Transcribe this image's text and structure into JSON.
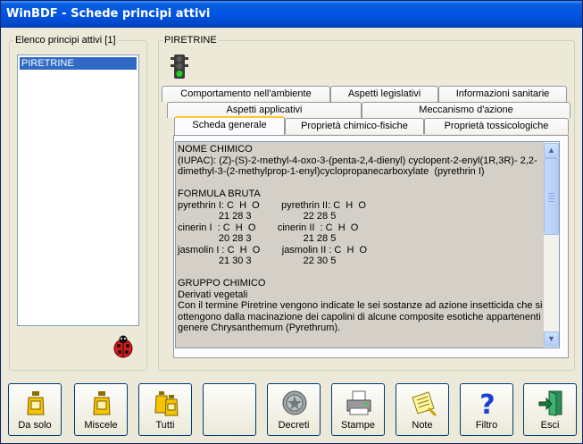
{
  "window": {
    "title": "WinBDF - Schede principi attivi"
  },
  "left_panel": {
    "legend": "Elenco principi attivi [1]",
    "items": [
      "PIRETRINE"
    ]
  },
  "right_panel": {
    "legend": "PIRETRINE",
    "tabs_row1": [
      "Comportamento nell'ambiente",
      "Aspetti legislativi",
      "Informazioni sanitarie"
    ],
    "tabs_row2": [
      "Aspetti applicativi",
      "Meccanismo d'azione"
    ],
    "tabs_row3": [
      "Scheda generale",
      "Proprietà chimico-fisiche",
      "Proprietà tossicologiche"
    ],
    "active_tab": "Scheda generale",
    "content_lines": [
      "NOME CHIMICO",
      "(IUPAC): (Z)-(S)-2-methyl-4-oxo-3-(penta-2,4-dienyl) cyclopent-2-enyl(1R,3R)- 2,2-",
      "dimethyl-3-(2-methylprop-1-enyl)cyclopropanecarboxylate  (pyrethrin I)",
      "",
      "FORMULA BRUTA",
      "pyrethrin I: C  H  O        pyrethrin II: C  H  O",
      "               21 28 3                   22 28 5",
      "cinerin I  : C  H  O        cinerin II  : C  H  O",
      "               20 28 3                   21 28 5",
      "jasmolin I : C  H  O        jasmolin II : C  H  O",
      "               21 30 3                   22 30 5",
      "",
      "GRUPPO CHIMICO",
      "Derivati vegetali",
      "Con il termine Piretrine vengono indicate le sei sostanze ad azione insetticida che si",
      "ottengono dalla macinazione dei capolini di alcune composite esotiche appartenenti al",
      "genere Chrysanthemum (Pyrethrum)."
    ]
  },
  "toolbar": {
    "buttons": [
      {
        "label": "Da solo",
        "icon": "bottle-icon"
      },
      {
        "label": "Miscele",
        "icon": "bottle-icon"
      },
      {
        "label": "Tutti",
        "icon": "bottles-icon"
      },
      {
        "label": "",
        "icon": ""
      },
      {
        "label": "Decreti",
        "icon": "emblem-icon"
      },
      {
        "label": "Stampe",
        "icon": "printer-icon"
      },
      {
        "label": "Note",
        "icon": "note-icon"
      },
      {
        "label": "Filtro",
        "icon": "question-icon"
      },
      {
        "label": "Esci",
        "icon": "exit-door-icon"
      }
    ]
  },
  "colors": {
    "titlebar": "#0054e3",
    "selection": "#316ac5",
    "window_bg": "#ece9d8",
    "text_bg": "#d4d0c8"
  }
}
